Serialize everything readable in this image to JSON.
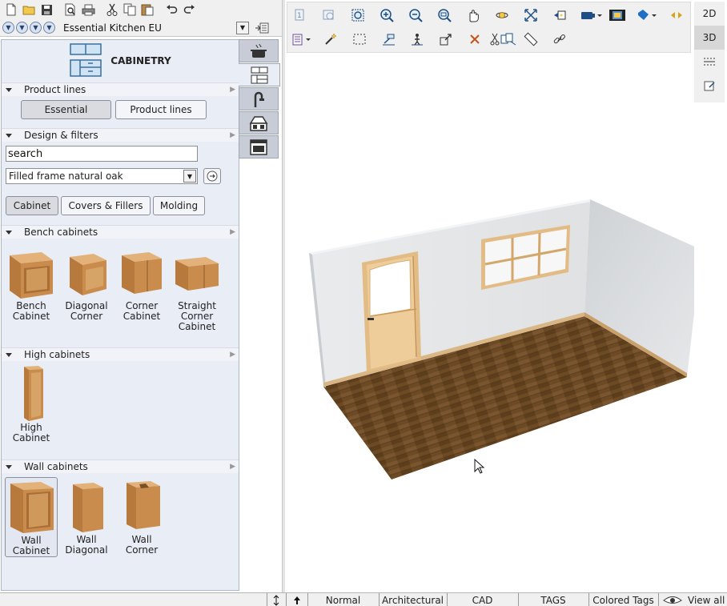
{
  "library": {
    "selected": "Essential Kitchen EU"
  },
  "catalog": {
    "title": "CABINETRY",
    "sections": {
      "product_lines": "Product lines",
      "design_filters": "Design & filters",
      "bench": "Bench cabinets",
      "high": "High cabinets",
      "wall": "Wall cabinets"
    },
    "product_line_buttons": [
      "Essential",
      "Product lines"
    ],
    "search": {
      "value": "search"
    },
    "style_select": "Filled frame natural oak",
    "category_buttons": [
      "Cabinet",
      "Covers & Fillers",
      "Molding"
    ],
    "bench_items": [
      "Bench Cabinet",
      "Diagonal Corner",
      "Corner Cabinet",
      "Straight Corner Cabinet"
    ],
    "high_items": [
      "High Cabinet"
    ],
    "wall_items": [
      "Wall Cabinet",
      "Wall Diagonal",
      "Wall Corner"
    ]
  },
  "view_modes": [
    "2D",
    "3D"
  ],
  "status_bar": {
    "modes": [
      "Normal",
      "Architectural",
      "CAD",
      "TAGS",
      "Colored Tags"
    ],
    "view_all": "View all"
  },
  "icons": {
    "left_toolbar": [
      "new-icon",
      "open-icon",
      "save-icon",
      "print-preview-icon",
      "print-icon",
      "cut-icon",
      "copy-icon",
      "paste-icon",
      "undo-icon",
      "redo-icon"
    ],
    "tabs": [
      "cooking-pot-icon",
      "cabinet-icon",
      "faucet-icon",
      "range-hood-icon",
      "oven-icon"
    ]
  },
  "colors": {
    "panel": "#e9edf6",
    "wood": "#c58a4a",
    "floor": "#6b4a24",
    "wall": "#e4e6e8"
  }
}
